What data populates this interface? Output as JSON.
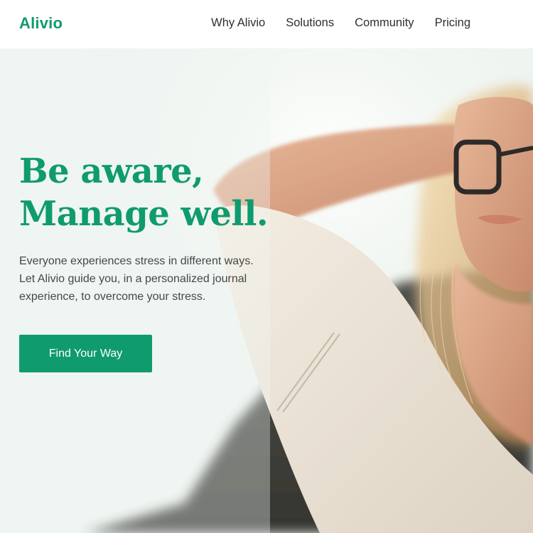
{
  "brand": {
    "name": "Alivio",
    "accent_color": "#0f9b6e"
  },
  "nav": {
    "items": [
      {
        "label": "Why Alivio"
      },
      {
        "label": "Solutions"
      },
      {
        "label": "Community"
      },
      {
        "label": "Pricing"
      }
    ]
  },
  "hero": {
    "headline_line1": "Be aware,",
    "headline_line2": "Manage well.",
    "description": "Everyone experiences stress in different ways. Let Alivio guide you, in a personalized journal experience, to overcome your stress.",
    "cta_label": "Find Your Way",
    "background_image": "woman-with-glasses-in-sunlight-photo"
  }
}
